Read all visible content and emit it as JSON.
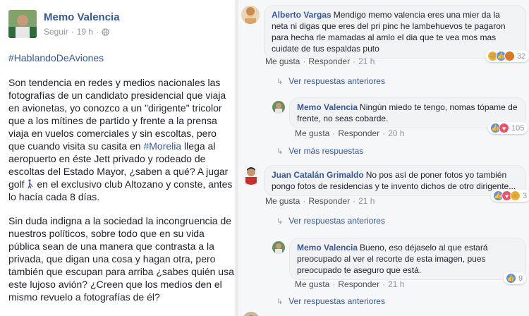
{
  "post": {
    "author": "Memo Valencia",
    "follow": "Seguir",
    "dot": "·",
    "time": "19 h",
    "hashtag": "#HablandoDeAviones",
    "para1_a": "Son tendencia en redes y medios nacionales las fotografías de un candidato presidencial que viaja en avionetas, yo conozco a un \"dirigente\" tricolor que a los mítines de partido y frente a la prensa viaja en vuelos comerciales y sin escoltas, pero que cuando visita su casita en ",
    "para1_link": "#Morelia",
    "para1_b": " llega al aeropuerto en éste Jett privado y rodeado de escoltas del Estado Mayor, ¿saben a qué? A jugar golf ",
    "para1_c": " en el exclusivo club Altozano y conste, antes lo hacía cada 8 días.",
    "para2": "Sin duda indigna a la sociedad la incongruencia de nuestros políticos, sobre todo que en su vida pública sean de una manera que contrasta a la privada, que digan una cosa y hagan otra, pero también que escupan para arriba ¿sabes quién usa este lujoso avión? ¿Creen que los medios den el mismo revuelo a fotografías de él?"
  },
  "colors": {
    "link": "#365899",
    "name": "#385898",
    "like": "#5890ff",
    "haha": "#f7b125",
    "angry": "#e9710f"
  },
  "actions": {
    "like": "Me gusta",
    "reply": "Responder",
    "dot": "·"
  },
  "comments": [
    {
      "name": "Alberto Vargas",
      "text": "Mendigo memo valencia eres una mier da la neta ni digas que eres del pri pinc he lambehuevos te pagaron para hecha rle mamadas al amlo el dia que te vea mos mas cuidate de tus espaldas puto",
      "time": "21 h",
      "reactions": 32,
      "icons": [
        "haha-icon",
        "like-icon",
        "angry-icon"
      ]
    },
    {
      "name": "Memo Valencia",
      "text": "Ningún miedo te tengo, nomas tópame de frente, no seas cobarde.",
      "time": "20 h",
      "reactions": 105,
      "icons": [
        "like-icon",
        "love-icon"
      ]
    },
    {
      "name": "Juan Catalán Grimaldo",
      "text": "No pos así de poner fotos yo también pongo fotos de residencias y te invento dichos de otro dirigente...",
      "time": "21 h",
      "reactions": 3,
      "icons": [
        "like-icon",
        "love-icon",
        "wow-icon"
      ]
    },
    {
      "name": "Memo Valencia",
      "text": "Bueno, eso déjaselo al que estará preocupado al ver el recorte de esta imagen, pues preocupado te aseguro que está.",
      "time": "21 h",
      "reactions": 9,
      "icons": [
        "like-icon"
      ]
    }
  ],
  "links": {
    "prev": "Ver respuestas anteriores",
    "more": "Ver más respuestas"
  }
}
